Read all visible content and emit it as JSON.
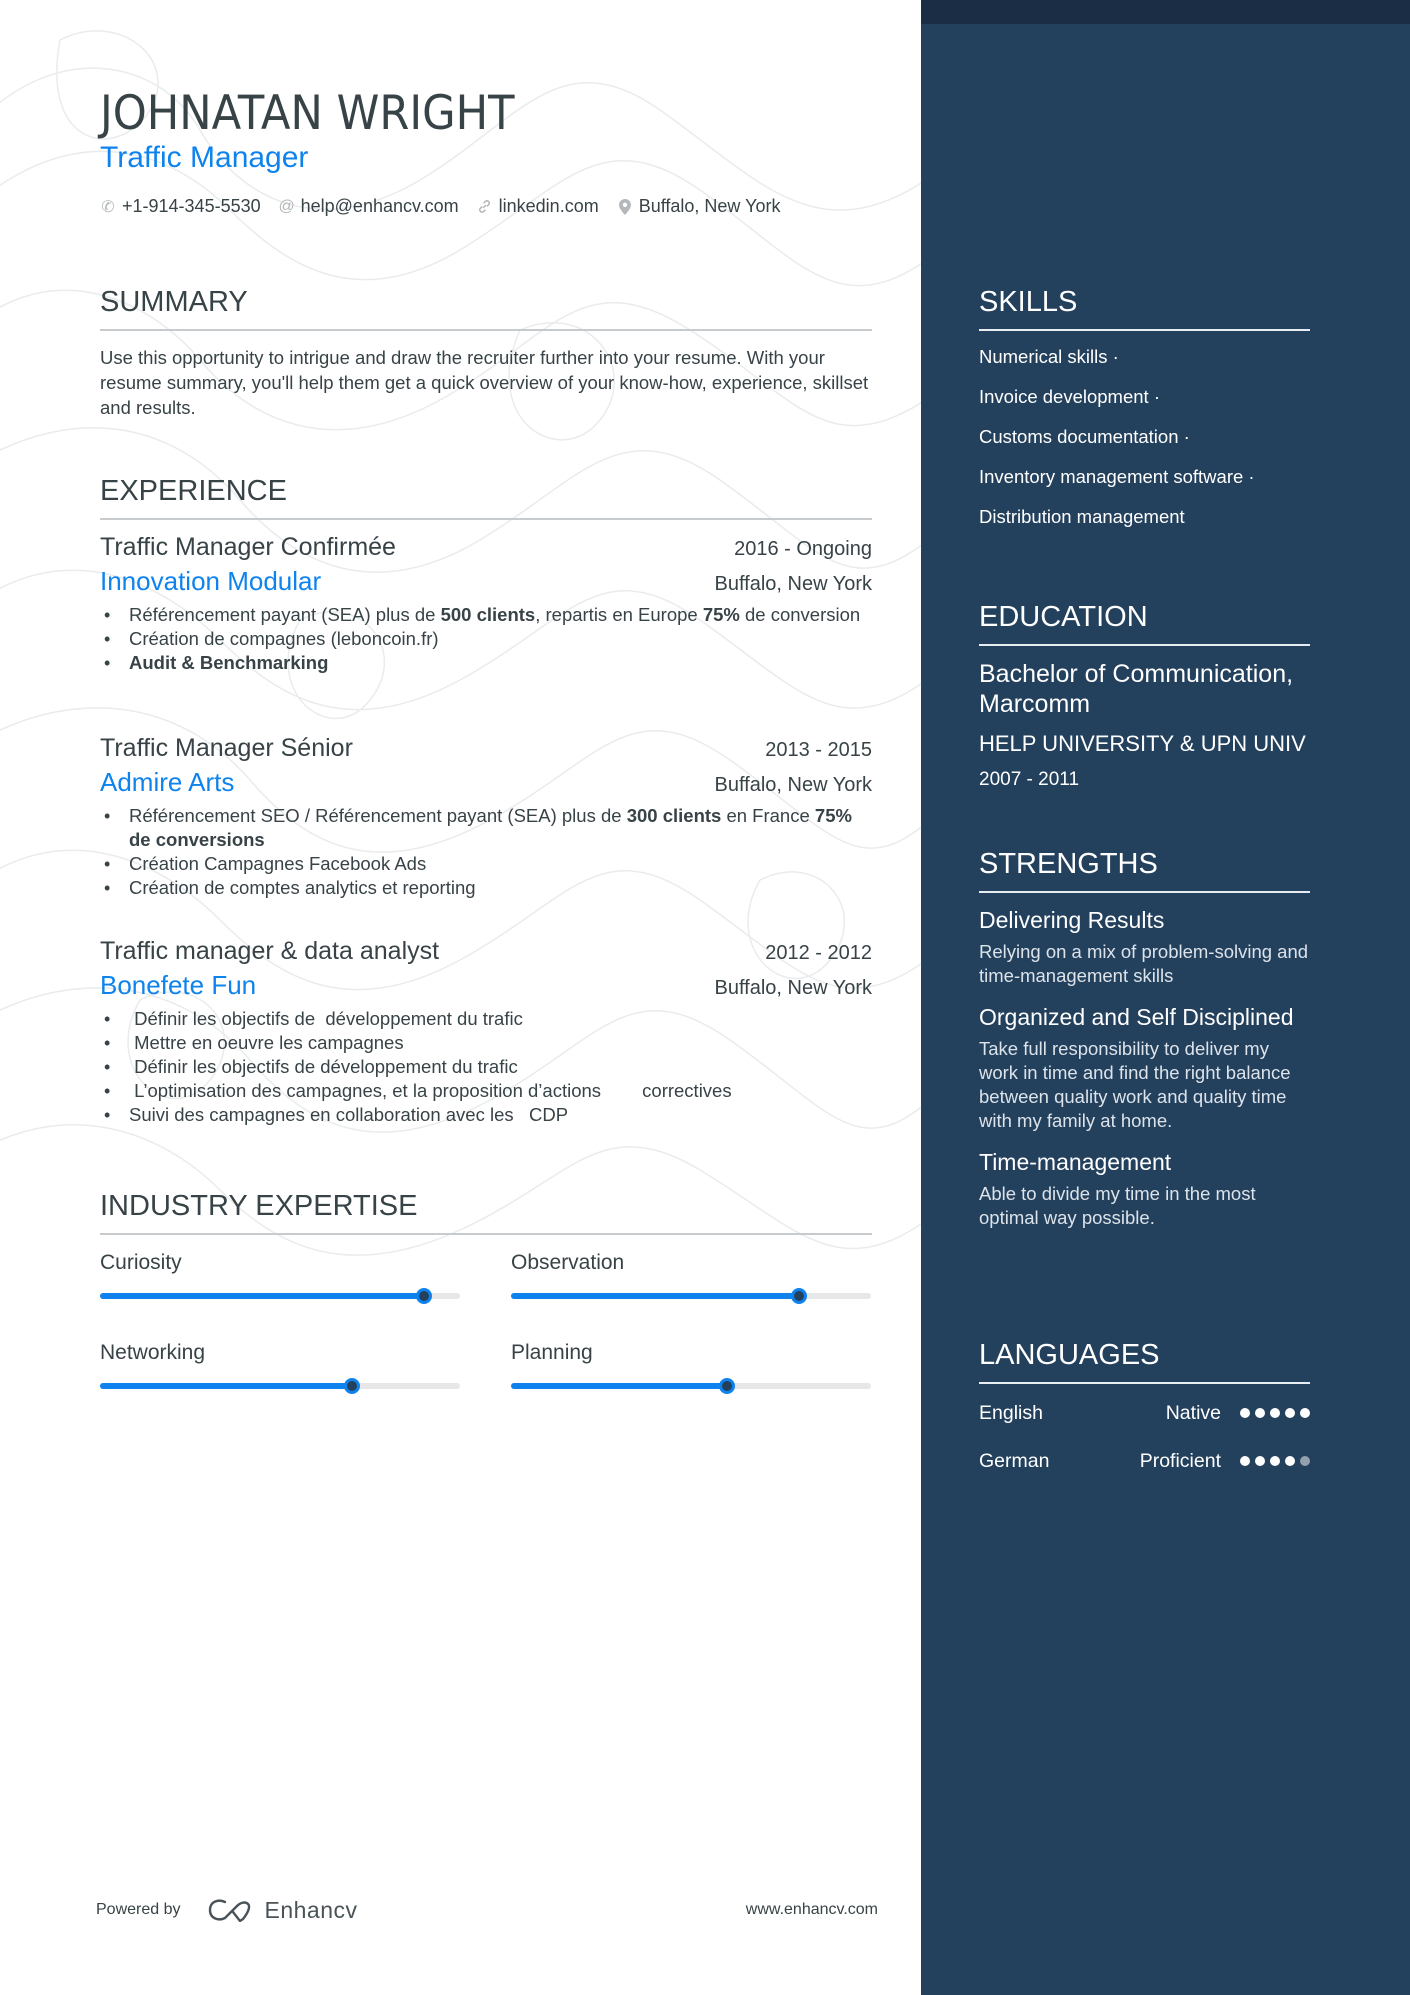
{
  "header": {
    "name": "JOHNATAN WRIGHT",
    "role": "Traffic Manager",
    "contacts": [
      {
        "icon": "phone-icon",
        "glyph": "✆",
        "text": "+1-914-345-5530"
      },
      {
        "icon": "at-icon",
        "glyph": "@",
        "text": "help@enhancv.com"
      },
      {
        "icon": "link-icon",
        "glyph": "🔗︎",
        "text": "linkedin.com"
      },
      {
        "icon": "location-pin-icon",
        "glyph": "⚲",
        "text": "Buffalo, New York"
      }
    ]
  },
  "summary": {
    "title": "SUMMARY",
    "text": "Use this opportunity to intrigue and draw the recruiter further into your resume. With your resume summary, you'll help them get a quick overview of your know-how, experience, skillset and results."
  },
  "experience": {
    "title": "EXPERIENCE",
    "jobs": [
      {
        "title": "Traffic Manager Confirmée",
        "dates": "2016 - Ongoing",
        "company": "Innovation Modular",
        "location": "Buffalo, New York",
        "bullets": [
          [
            {
              "t": "Référencement payant (SEA) plus de "
            },
            {
              "t": "500 clients",
              "b": true
            },
            {
              "t": ", repartis en Europe "
            },
            {
              "t": "75%",
              "b": true
            },
            {
              "t": " de conversion"
            }
          ],
          [
            {
              "t": "Création de compagnes (leboncoin.fr)"
            }
          ],
          [
            {
              "t": "Audit & Benchmarking",
              "b": true
            }
          ]
        ]
      },
      {
        "title": "Traffic Manager Sénior",
        "dates": "2013 - 2015",
        "company": "Admire Arts",
        "location": "Buffalo, New York",
        "bullets": [
          [
            {
              "t": "Référencement SEO / Référencement payant (SEA) plus de "
            },
            {
              "t": "300 clients",
              "b": true
            },
            {
              "t": " en France "
            },
            {
              "t": "75% de conversions",
              "b": true
            }
          ],
          [
            {
              "t": "Création Campagnes Facebook Ads"
            }
          ],
          [
            {
              "t": "Création de comptes analytics et reporting"
            }
          ]
        ]
      },
      {
        "title": "Traffic manager & data analyst",
        "dates": "2012 - 2012",
        "company": "Bonefete Fun",
        "location": "Buffalo, New York",
        "bullets": [
          [
            {
              "t": " Définir les objectifs de  développement du trafic"
            }
          ],
          [
            {
              "t": " Mettre en oeuvre les campagnes"
            }
          ],
          [
            {
              "t": " Définir les objectifs de développement du trafic"
            }
          ],
          [
            {
              "t": " L’optimisation des campagnes, et la proposition d’actions        correctives"
            }
          ],
          [
            {
              "t": "Suivi des campagnes en collaboration avec les   CDP"
            }
          ]
        ]
      }
    ]
  },
  "expertise": {
    "title": "INDUSTRY EXPERTISE",
    "items": [
      {
        "label": "Curiosity",
        "level": 0.9
      },
      {
        "label": "Observation",
        "level": 0.8
      },
      {
        "label": "Networking",
        "level": 0.7
      },
      {
        "label": "Planning",
        "level": 0.6
      }
    ]
  },
  "skills": {
    "title": "SKILLS",
    "items": [
      "Numerical skills ·",
      "Invoice development ·",
      "Customs documentation ·",
      "Inventory management software ·",
      "Distribution management"
    ]
  },
  "education": {
    "title": "EDUCATION",
    "degree": "Bachelor of Communication, Marcomm",
    "school": "HELP UNIVERSITY & UPN UNIV",
    "dates": "2007 - 2011"
  },
  "strengths": {
    "title": "STRENGTHS",
    "items": [
      {
        "title": "Delivering Results",
        "desc": "Relying on a mix of problem-solving and time-management skills"
      },
      {
        "title": "Organized and Self Disciplined",
        "desc": "Take full responsibility to deliver my work in time and find the right balance between quality work and quality time with my family at home."
      },
      {
        "title": "Time-management",
        "desc": "Able to divide my time in the most optimal way possible."
      }
    ]
  },
  "languages": {
    "title": "LANGUAGES",
    "items": [
      {
        "name": "English",
        "level": "Native",
        "rating": 5,
        "max": 5
      },
      {
        "name": "German",
        "level": "Proficient",
        "rating": 4,
        "max": 5
      }
    ]
  },
  "footer": {
    "powered_by": "Powered by",
    "brand": "Enhancv",
    "site": "www.enhancv.com"
  },
  "colors": {
    "accent": "#0f83ed",
    "sidebar": "#23405d",
    "sidebar_top": "#1a2d44",
    "text": "#384347"
  }
}
